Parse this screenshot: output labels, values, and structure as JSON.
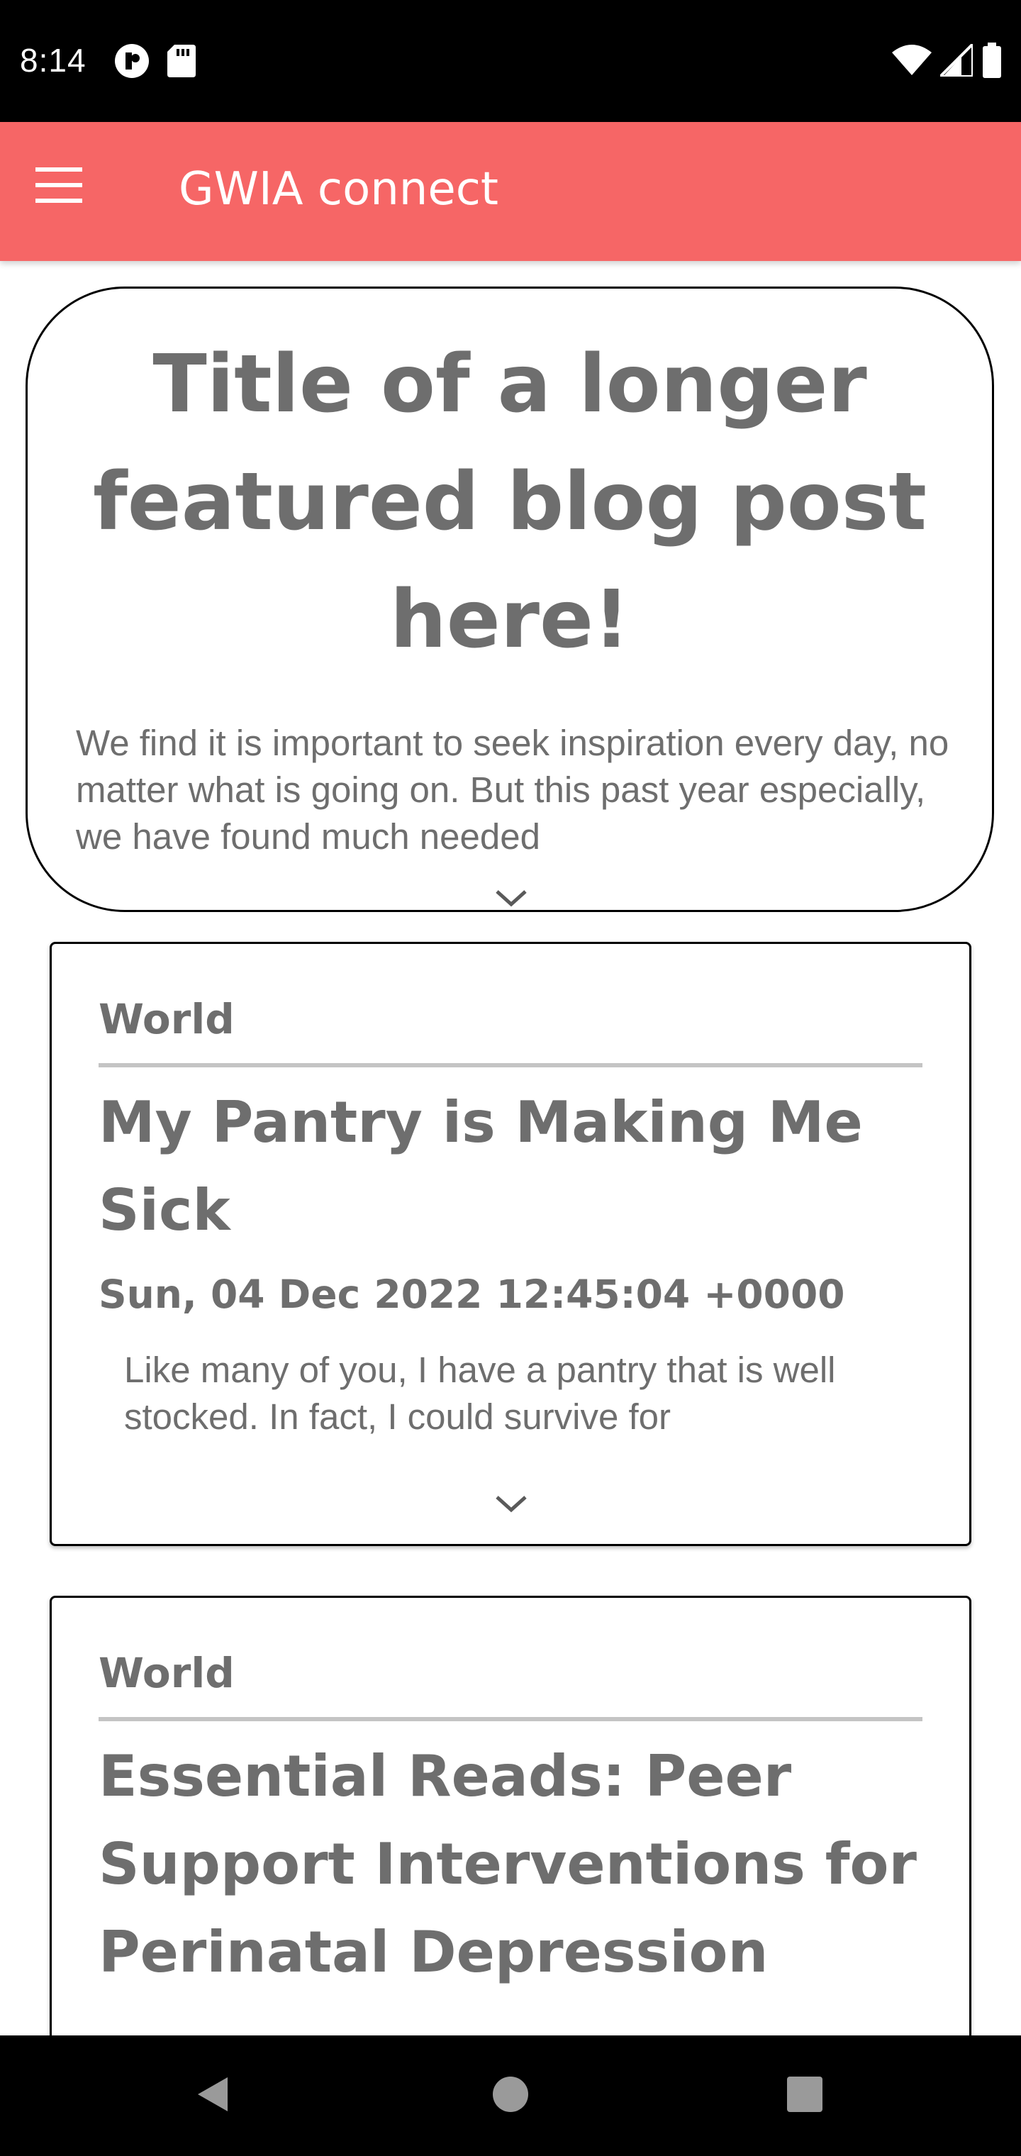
{
  "status_bar": {
    "time": "8:14",
    "left_icons": [
      "notification-icon",
      "sd-card-icon"
    ],
    "right_icons": [
      "wifi-icon",
      "signal-icon",
      "battery-icon"
    ]
  },
  "app_bar": {
    "title": "GWIA connect",
    "menu_icon": "hamburger-menu-icon",
    "background_color": "#f66666"
  },
  "featured_post": {
    "title": "Title of a longer featured blog post here!",
    "excerpt": "We find it is important to seek inspiration every day, no matter what is going on. But this past year especially, we have found much needed",
    "expand_icon": "chevron-down-icon"
  },
  "posts": [
    {
      "category": "World",
      "title": "My Pantry is Making Me Sick",
      "date": "Sun, 04 Dec 2022 12:45:04 +0000",
      "excerpt": "Like many of you, I have a pantry that is well stocked. In fact, I could survive for",
      "expand_icon": "chevron-down-icon"
    },
    {
      "category": "World",
      "title": "Essential Reads: Peer Support Interventions for Perinatal Depression"
    }
  ],
  "nav_bar": {
    "icons": [
      "back-icon",
      "home-icon",
      "recents-icon"
    ]
  },
  "colors": {
    "accent": "#f66666",
    "text_gray": "#6e6e6e",
    "divider": "#c4c4c4"
  }
}
